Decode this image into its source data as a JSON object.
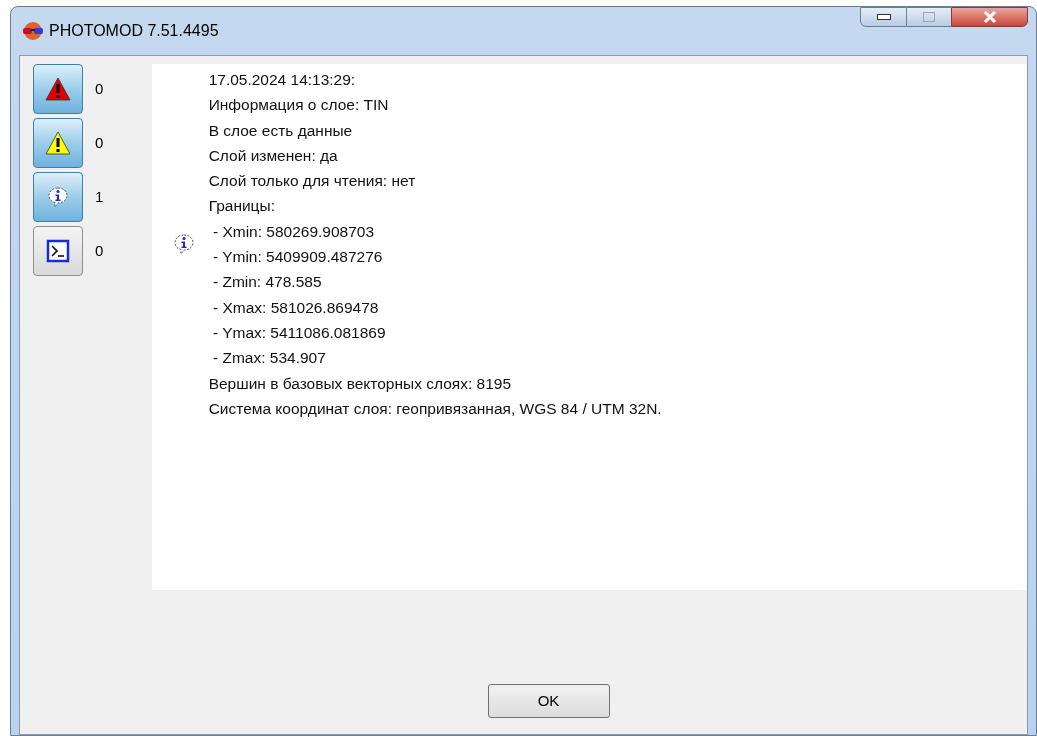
{
  "window": {
    "title": "PHOTOMOD 7.51.4495"
  },
  "filters": [
    {
      "kind": "error",
      "count": "0",
      "selected": true
    },
    {
      "kind": "warning",
      "count": "0",
      "selected": true
    },
    {
      "kind": "info",
      "count": "1",
      "selected": true
    },
    {
      "kind": "console",
      "count": "0",
      "selected": false
    }
  ],
  "messages": [
    {
      "kind": "info",
      "lines": [
        "17.05.2024 14:13:29:",
        "Информация о слое: TIN",
        "В слое есть данные",
        "Слой изменен: да",
        "Слой только для чтения: нет",
        "Границы:",
        " - Xmin: 580269.908703",
        " - Ymin: 5409909.487276",
        " - Zmin: 478.585",
        " - Xmax: 581026.869478",
        " - Ymax: 5411086.081869",
        " - Zmax: 534.907",
        "Вершин в базовых векторных слоях: 8195",
        "Система координат слоя: геопривязанная, WGS 84 / UTM 32N."
      ]
    }
  ],
  "buttons": [
    "OK"
  ]
}
